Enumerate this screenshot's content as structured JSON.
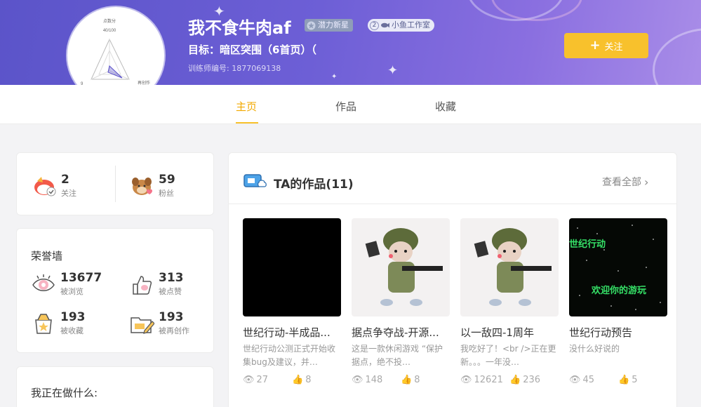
{
  "profile": {
    "username": "我不食牛肉af",
    "badge_rising": "潜力新星",
    "badge_studio_num": "2",
    "badge_studio": "小鱼工作室",
    "goal": "目标：暗区突围（6首页）（",
    "trainer": "训练师编号: 1877069138",
    "radar_top_label": "点数分",
    "radar_top_value": "40/100",
    "radar_right_label": "再创作",
    "radar_right_value": "67",
    "radar_left_value": "9"
  },
  "actions": {
    "follow_label": "关注"
  },
  "tabs": [
    {
      "label": "主页"
    },
    {
      "label": "作品"
    },
    {
      "label": "收藏"
    }
  ],
  "social": {
    "following_count": "2",
    "following_label": "关注",
    "fans_count": "59",
    "fans_label": "粉丝"
  },
  "honor": {
    "title": "荣誉墙",
    "views": "13677",
    "views_label": "被浏览",
    "likes": "313",
    "likes_label": "被点赞",
    "favs": "193",
    "favs_label": "被收藏",
    "remix": "193",
    "remix_label": "被再创作"
  },
  "doing": {
    "title": "我正在做什么:"
  },
  "works": {
    "title": "TA的作品(11)",
    "view_all": "查看全部",
    "items": [
      {
        "title": "世纪行动-半成品...",
        "desc": "世纪行动公测正式开始收集bug及建议，并…",
        "views": "27",
        "likes": "8"
      },
      {
        "title": "据点争夺战-开源...",
        "desc": "这是一款休闲游戏 “保护据点，绝不投…",
        "views": "148",
        "likes": "8"
      },
      {
        "title": "以一敌四-1周年",
        "desc": "我吃好了！<br />正在更新。。。一年没…",
        "views": "12621",
        "likes": "236"
      },
      {
        "title": "世纪行动预告",
        "desc": "没什么好说的",
        "views": "45",
        "likes": "5"
      }
    ],
    "thumb4_line1": "世纪行动",
    "thumb4_line2": "欢迎你的游玩"
  },
  "colors": {
    "accent": "#f8c12c",
    "banner": "#6d5fd6"
  }
}
